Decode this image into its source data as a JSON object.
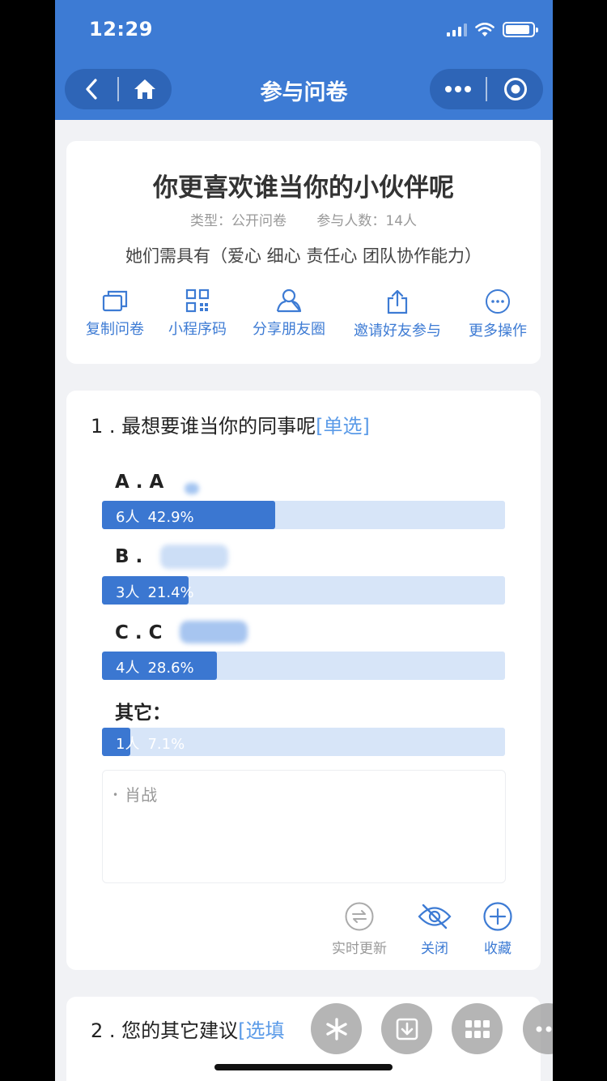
{
  "status": {
    "time": "12:29"
  },
  "header": {
    "title": "参与问卷"
  },
  "survey": {
    "title": "你更喜欢谁当你的小伙伴呢",
    "type": "类型：公开问卷",
    "participants": "参与人数：14人",
    "description": "她们需具有（爱心 细心 责任心 团队协作能力）"
  },
  "actions": [
    {
      "label": "复制问卷",
      "icon": "copy-icon"
    },
    {
      "label": "小程序码",
      "icon": "qrcode-icon"
    },
    {
      "label": "分享朋友圈",
      "icon": "user-share-icon"
    },
    {
      "label": "邀请好友参与",
      "icon": "share-upload-icon"
    },
    {
      "label": "更多操作",
      "icon": "more-icon"
    }
  ],
  "q1": {
    "title": "1 . 最想要谁当你的同事呢",
    "type": "[单选]",
    "options": [
      {
        "label": "A . A",
        "count": "6人",
        "percent": "42.9%",
        "ratio": 0.429
      },
      {
        "label": "B .",
        "count": "3人",
        "percent": "21.4%",
        "ratio": 0.214
      },
      {
        "label": "C . C",
        "count": "4人",
        "percent": "28.6%",
        "ratio": 0.286
      },
      {
        "label": "其它：",
        "count": "1人",
        "percent": "7.1%",
        "ratio": 0.071
      }
    ],
    "other_entries": [
      "肖战"
    ],
    "actions": [
      {
        "label": "实时更新",
        "icon": "refresh-icon",
        "color": "#999999"
      },
      {
        "label": "关闭",
        "icon": "eye-off-icon",
        "color": "#3d7bd4"
      },
      {
        "label": "收藏",
        "icon": "plus-circle-icon",
        "color": "#3d7bd4"
      }
    ]
  },
  "q2": {
    "title": "2 . 您的其它建议",
    "type": "[选填"
  },
  "colors": {
    "brand": "#3d7bd4",
    "bar_fill": "#3b77d1",
    "bar_track": "#d7e5f8"
  }
}
